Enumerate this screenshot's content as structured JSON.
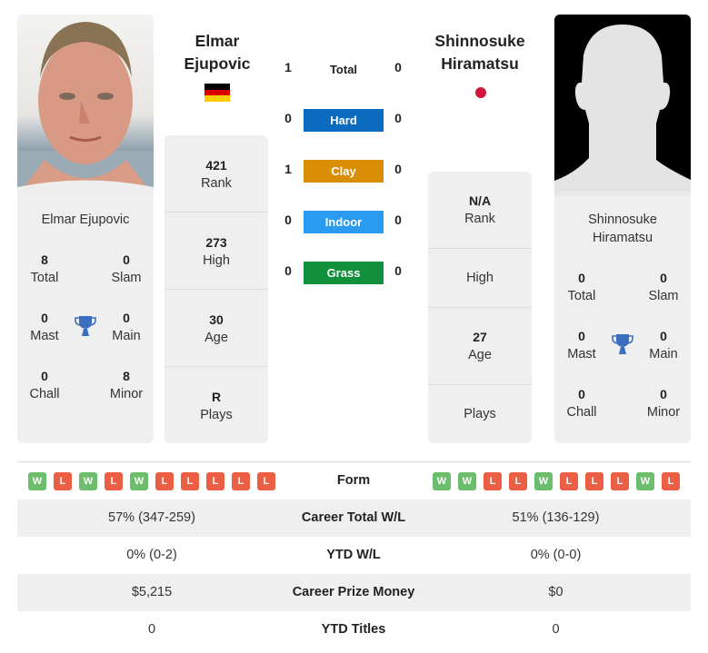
{
  "player1": {
    "name_line1": "Elmar",
    "name_line2": "Ejupovic",
    "full_name": "Elmar Ejupovic",
    "flag": "germany-flag",
    "flag_colors": [
      "#000000",
      "#dd0000",
      "#ffce00"
    ],
    "titles": {
      "total": {
        "value": "8",
        "label": "Total"
      },
      "slam": {
        "value": "0",
        "label": "Slam"
      },
      "mast": {
        "value": "0",
        "label": "Mast"
      },
      "main": {
        "value": "0",
        "label": "Main"
      },
      "chall": {
        "value": "0",
        "label": "Chall"
      },
      "minor": {
        "value": "8",
        "label": "Minor"
      }
    },
    "stats": [
      {
        "value": "421",
        "label": "Rank"
      },
      {
        "value": "273",
        "label": "High"
      },
      {
        "value": "30",
        "label": "Age"
      },
      {
        "value": "R",
        "label": "Plays"
      }
    ],
    "form": [
      "W",
      "L",
      "W",
      "L",
      "W",
      "L",
      "L",
      "L",
      "L",
      "L"
    ]
  },
  "player2": {
    "name_line1": "Shinnosuke",
    "name_line2": "Hiramatsu",
    "full_name_line1": "Shinnosuke",
    "full_name_line2": "Hiramatsu",
    "flag": "japan-flag",
    "flag_colors": [
      "#bc002d"
    ],
    "titles": {
      "total": {
        "value": "0",
        "label": "Total"
      },
      "slam": {
        "value": "0",
        "label": "Slam"
      },
      "mast": {
        "value": "0",
        "label": "Mast"
      },
      "main": {
        "value": "0",
        "label": "Main"
      },
      "chall": {
        "value": "0",
        "label": "Chall"
      },
      "minor": {
        "value": "0",
        "label": "Minor"
      }
    },
    "stats": [
      {
        "value": "N/A",
        "label": "Rank"
      },
      {
        "value": "",
        "label": "High"
      },
      {
        "value": "27",
        "label": "Age"
      },
      {
        "value": "",
        "label": "Plays"
      }
    ],
    "form": [
      "W",
      "W",
      "L",
      "L",
      "W",
      "L",
      "L",
      "L",
      "W",
      "L"
    ]
  },
  "h2h": {
    "total": {
      "label": "Total",
      "p1": "1",
      "p2": "0"
    },
    "surfaces": [
      {
        "label": "Hard",
        "p1": "0",
        "p2": "0",
        "color": "#0b6cbf"
      },
      {
        "label": "Clay",
        "p1": "1",
        "p2": "0",
        "color": "#d98e06"
      },
      {
        "label": "Indoor",
        "p1": "0",
        "p2": "0",
        "color": "#2a9bef"
      },
      {
        "label": "Grass",
        "p1": "0",
        "p2": "0",
        "color": "#12913d"
      }
    ]
  },
  "comparison": {
    "form_label": "Form",
    "rows": [
      {
        "label": "Career Total W/L",
        "p1": "57% (347-259)",
        "p2": "51% (136-129)"
      },
      {
        "label": "YTD W/L",
        "p1": "0% (0-2)",
        "p2": "0% (0-0)"
      },
      {
        "label": "Career Prize Money",
        "p1": "$5,215",
        "p2": "$0"
      },
      {
        "label": "YTD Titles",
        "p1": "0",
        "p2": "0"
      }
    ]
  },
  "colors": {
    "win": "#6cbe6c",
    "loss": "#ec5f45",
    "trophy": "#3a6fbf",
    "card_bg": "#efefef"
  }
}
